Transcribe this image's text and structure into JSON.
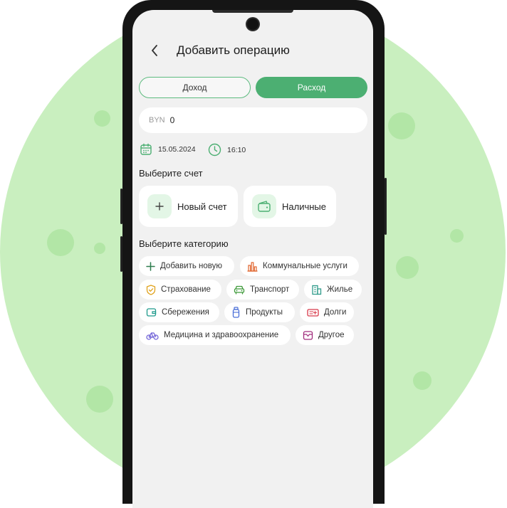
{
  "header": {
    "title": "Добавить операцию"
  },
  "tabs": {
    "income": "Доход",
    "expense": "Расход"
  },
  "amount": {
    "currency": "BYN",
    "value": "0"
  },
  "meta": {
    "date": "15.05.2024",
    "time": "16:10"
  },
  "accounts": {
    "heading": "Выберите счет",
    "items": [
      {
        "label": "Новый счет",
        "icon": "plus-icon"
      },
      {
        "label": "Наличные",
        "icon": "wallet-icon"
      }
    ]
  },
  "categories": {
    "heading": "Выберите категорию",
    "items": [
      {
        "label": "Добавить новую",
        "icon": "plus-icon",
        "color": "#2e7d4f"
      },
      {
        "label": "Коммунальные услуги",
        "icon": "bar-chart-icon",
        "color": "#e0632c"
      },
      {
        "label": "Страхование",
        "icon": "shield-icon",
        "color": "#e0a21c"
      },
      {
        "label": "Транспорт",
        "icon": "car-icon",
        "color": "#3f9a3a"
      },
      {
        "label": "Жилье",
        "icon": "building-icon",
        "color": "#2f9b8a"
      },
      {
        "label": "Сбережения",
        "icon": "wallet-icon",
        "color": "#1f9a8c"
      },
      {
        "label": "Продукты",
        "icon": "bottle-icon",
        "color": "#4a6fd8"
      },
      {
        "label": "Долги",
        "icon": "ticket-icon",
        "color": "#d8394a"
      },
      {
        "label": "Медицина и здравоохранение",
        "icon": "bike-icon",
        "color": "#6b5cd6"
      },
      {
        "label": "Другое",
        "icon": "case-icon",
        "color": "#a12d7d"
      }
    ]
  },
  "colors": {
    "accent": "#4caf72",
    "background": "#c9efbf"
  }
}
